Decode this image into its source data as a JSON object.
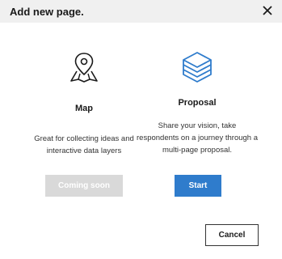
{
  "dialog": {
    "title": "Add new page.",
    "close_icon": "close-icon"
  },
  "options": [
    {
      "icon": "map-pin-icon",
      "title": "Map",
      "description": "Great for collecting ideas and interactive data layers",
      "button_label": "Coming soon",
      "button_enabled": false
    },
    {
      "icon": "stacked-layers-icon",
      "title": "Proposal",
      "description": "Share your vision, take respondents on a journey through a multi-page proposal.",
      "button_label": "Start",
      "button_enabled": true
    }
  ],
  "footer": {
    "cancel_label": "Cancel"
  },
  "colors": {
    "accent": "#2f7ccc",
    "disabled": "#d9d9d9",
    "header_bg": "#f0f0f0"
  }
}
